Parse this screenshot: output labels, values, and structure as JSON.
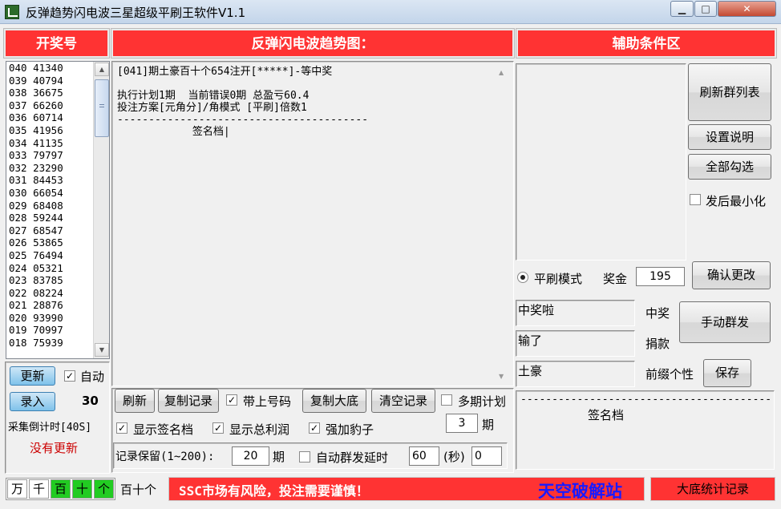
{
  "window": {
    "title": "反弹趋势闪电波三星超级平刷王软件V1.1",
    "min_icon": "minimize-icon",
    "max_icon": "maximize-icon",
    "close_icon": "close-icon"
  },
  "colors": {
    "header_red": "#ff3333",
    "status_red": "#ff3333",
    "blue_brand": "#1a1aff",
    "dark_red_text": "#cc0000"
  },
  "left": {
    "header": "开奖号",
    "rows": [
      "040 41340",
      "039 40794",
      "038 36675",
      "037 66260",
      "036 60714",
      "035 41956",
      "034 41135",
      "033 79797",
      "032 23290",
      "031 84453",
      "030 66054",
      "029 68408",
      "028 59244",
      "027 68547",
      "026 53865",
      "025 76494",
      "024 05321",
      "023 83785",
      "022 08224",
      "021 28876",
      "020 93990",
      "019 70997",
      "018 75939"
    ],
    "update_btn": "更新",
    "auto_label": "自动",
    "auto_checked": true,
    "entry_btn": "录入",
    "entry_count": "30",
    "countdown": "采集倒计时[40S]",
    "no_update": "没有更新"
  },
  "center": {
    "header": "反弹闪电波趋势图：",
    "log_lines": [
      "[041]期土豪百十个654注开[*****]-等中奖",
      "",
      "执行计划1期  当前错误0期 总盈亏60.4",
      "投注方案[元角分]/角模式 [平刷]倍数1",
      "----------------------------------------",
      "            签名档|"
    ],
    "btn_refresh": "刷新",
    "btn_copy_record": "复制记录",
    "chk_with_number": "带上号码",
    "chk_with_number_checked": true,
    "btn_copy_base": "复制大底",
    "btn_clear": "清空记录",
    "chk_multi_plan": "多期计划",
    "chk_multi_plan_checked": false,
    "multi_plan_value": "3",
    "multi_plan_unit": "期",
    "chk_show_sig": "显示签名档",
    "chk_show_sig_checked": true,
    "chk_show_profit": "显示总利润",
    "chk_show_profit_checked": true,
    "chk_force_leopard": "强加豹子",
    "chk_force_leopard_checked": true,
    "keep_label": "记录保留(1~200):",
    "keep_value": "20",
    "keep_unit": "期",
    "chk_auto_delay": "自动群发延时",
    "chk_auto_delay_checked": false,
    "delay_value": "60",
    "delay_unit": "(秒)",
    "delay_counter": "0"
  },
  "right": {
    "header": "辅助条件区",
    "btn_refresh_groups": "刷新群列表",
    "btn_settings_help": "设置说明",
    "btn_select_all": "全部勾选",
    "chk_minimize": "发后最小化",
    "chk_minimize_checked": false,
    "radio_flat_mode": "平刷模式",
    "prize_label": "奖金",
    "prize_value": "195",
    "btn_confirm": "确认更改",
    "win_text": "中奖啦",
    "win_label": "中奖",
    "lose_text": "输了",
    "lose_label": "捐款",
    "prefix_text": "土豪",
    "prefix_label": "前缀个性",
    "btn_manual_send": "手动群发",
    "btn_save": "保存",
    "sig_preview_dash": "----------------------------------------",
    "sig_preview_text": "签名档"
  },
  "status": {
    "digits": [
      {
        "label": "万",
        "active": false
      },
      {
        "label": "千",
        "active": false
      },
      {
        "label": "百",
        "active": true
      },
      {
        "label": "十",
        "active": true
      },
      {
        "label": "个",
        "active": true
      }
    ],
    "position_text": "百十个",
    "warning": "SSC市场有风险，投注需要谨慎！",
    "brand": "天空破解站",
    "stats_btn": "大底统计记录"
  }
}
